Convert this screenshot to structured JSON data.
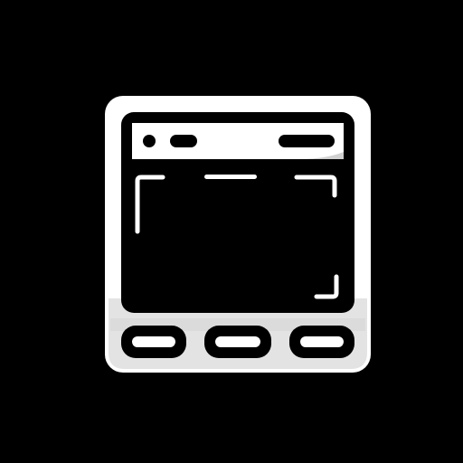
{
  "icon": {
    "name": "browser-window-icon",
    "colors": {
      "background": "#000000",
      "body": "#ffffff",
      "outline": "#000000",
      "shade": "#d9d9d9",
      "screen": "#000000",
      "detail": "#ffffff"
    }
  },
  "bottom_buttons": [
    {
      "name": "left-button"
    },
    {
      "name": "middle-button"
    },
    {
      "name": "right-button"
    }
  ]
}
